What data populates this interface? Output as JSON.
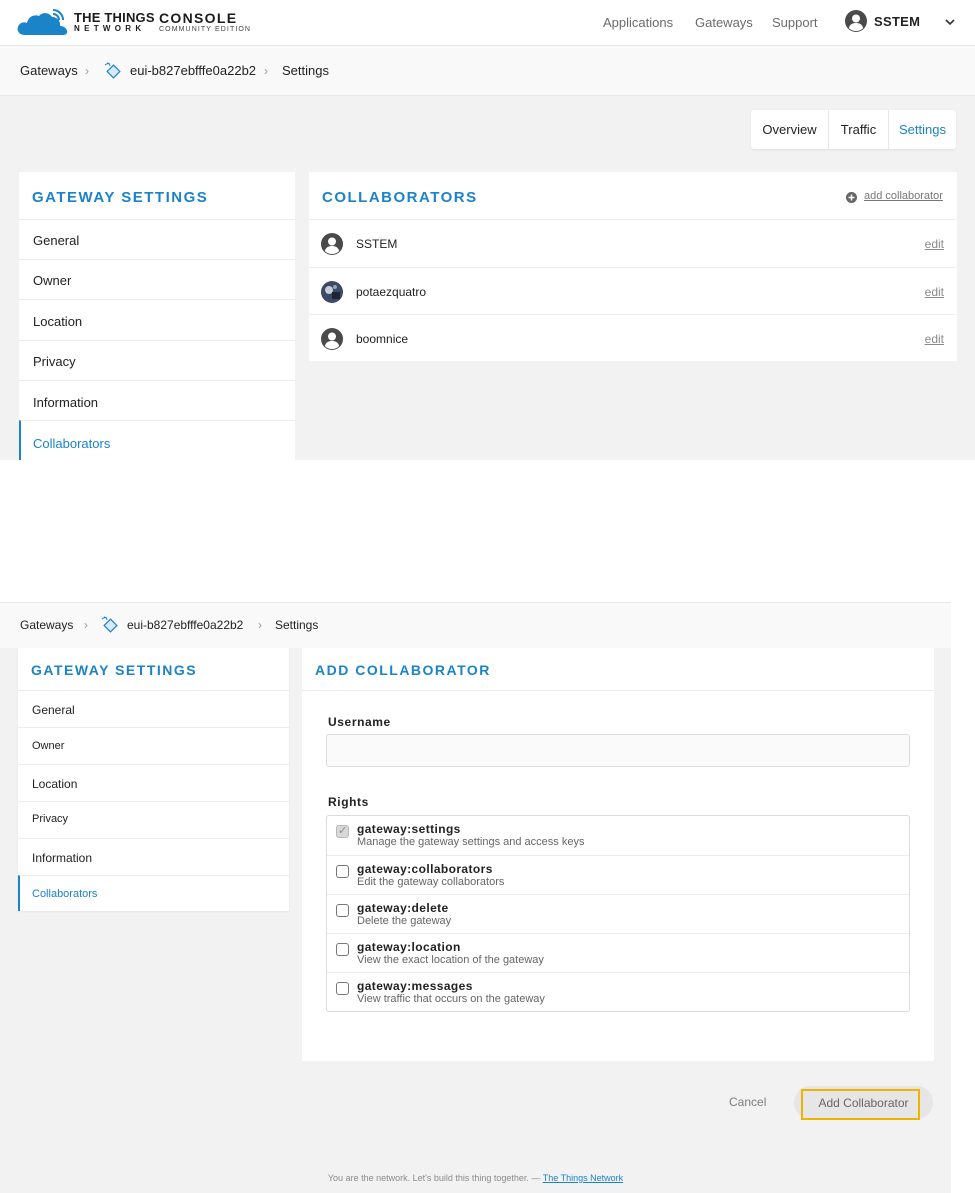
{
  "brand": {
    "line1": "THE THINGS",
    "line2": "NETWORK",
    "console": "CONSOLE",
    "edition": "COMMUNITY EDITION",
    "accent": "#1b83c8"
  },
  "nav": {
    "applications": "Applications",
    "gateways": "Gateways",
    "support": "Support",
    "user": "SSTEM"
  },
  "breadcrumb": {
    "root": "Gateways",
    "gateway_id": "eui-b827ebfffe0a22b2",
    "current": "Settings"
  },
  "tabs": {
    "overview": "Overview",
    "traffic": "Traffic",
    "settings": "Settings",
    "active": "Settings"
  },
  "settings_menu": {
    "title": "GATEWAY SETTINGS",
    "items": [
      "General",
      "Owner",
      "Location",
      "Privacy",
      "Information",
      "Collaborators"
    ],
    "active": "Collaborators"
  },
  "collaborators": {
    "title": "COLLABORATORS",
    "add_label": "add collaborator",
    "edit_label": "edit",
    "list": [
      {
        "name": "SSTEM",
        "avatar": "person-icon"
      },
      {
        "name": "potaezquatro",
        "avatar": "photo-avatar"
      },
      {
        "name": "boomnice",
        "avatar": "person-icon"
      }
    ]
  },
  "add_collaborator": {
    "title": "ADD COLLABORATOR",
    "username_label": "Username",
    "username_value": "",
    "rights_label": "Rights",
    "rights": [
      {
        "name": "gateway:settings",
        "description": "Manage the gateway settings and access keys",
        "checked": true
      },
      {
        "name": "gateway:collaborators",
        "description": "Edit the gateway collaborators",
        "checked": false
      },
      {
        "name": "gateway:delete",
        "description": "Delete the gateway",
        "checked": false
      },
      {
        "name": "gateway:location",
        "description": "View the exact location of the gateway",
        "checked": false
      },
      {
        "name": "gateway:messages",
        "description": "View traffic that occurs on the gateway",
        "checked": false
      }
    ],
    "cancel_label": "Cancel",
    "submit_label": "Add Collaborator"
  },
  "footer": {
    "text": "You are the network. Let's build this thing together. — ",
    "link": "The Things Network"
  }
}
